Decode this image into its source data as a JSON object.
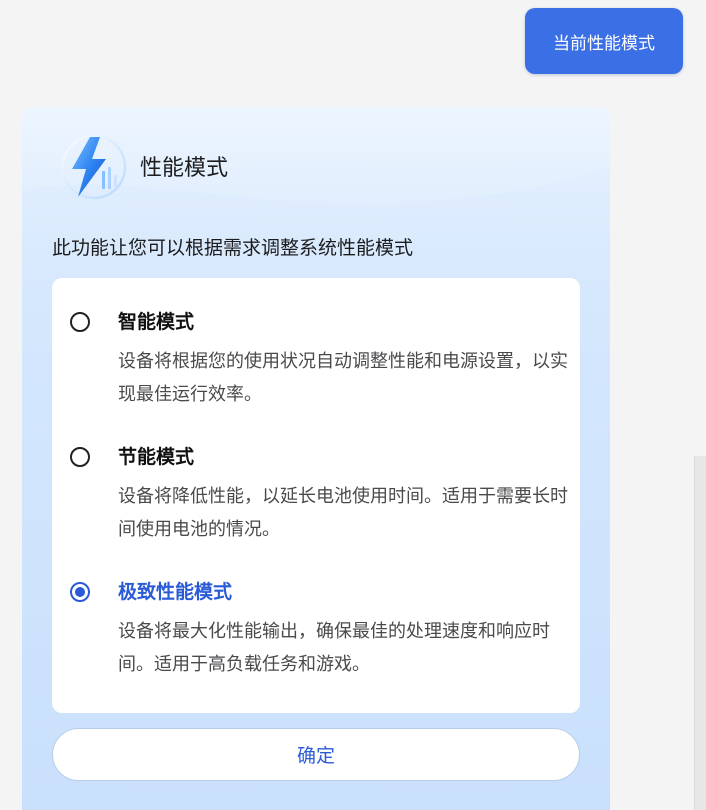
{
  "top_button": {
    "label": "当前性能模式"
  },
  "card": {
    "title": "性能模式",
    "subtitle": "此功能让您可以根据需求调整系统性能模式",
    "logo_icon": "lightning-bolt-icon",
    "options": [
      {
        "title": "智能模式",
        "description": "设备将根据您的使用状况自动调整性能和电源设置，以实现最佳运行效率。",
        "selected": false
      },
      {
        "title": "节能模式",
        "description": "设备将降低性能，以延长电池使用时间。适用于需要长时间使用电池的情况。",
        "selected": false
      },
      {
        "title": "极致性能模式",
        "description": "设备将最大化性能输出，确保最佳的处理速度和响应时间。适用于高负载任务和游戏。",
        "selected": true
      }
    ],
    "confirm_label": "确定"
  },
  "colors": {
    "accent": "#2a5bd7",
    "top_button_bg": "#3b6fe6",
    "card_bg": "#d4e7fd"
  }
}
